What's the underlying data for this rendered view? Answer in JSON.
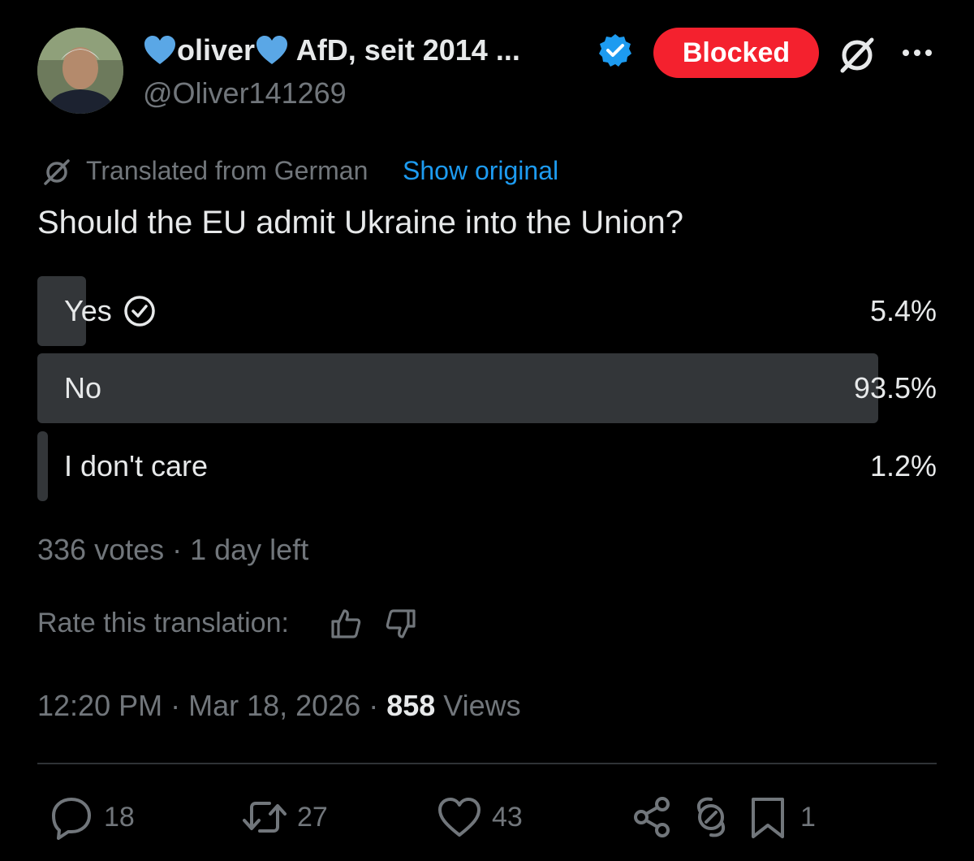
{
  "author": {
    "name_main": "oliver",
    "name_suffix": " AfD, seit 2014 ...",
    "handle": "@Oliver141269",
    "verified": true,
    "heart_color": "#5aa7e6",
    "verified_color": "#1d9bf0"
  },
  "header": {
    "blocked_label": "Blocked",
    "blocked_color": "#f4212e"
  },
  "translation": {
    "label": "Translated from German",
    "show_original": "Show original"
  },
  "post": {
    "text": "Should the EU admit Ukraine into the Union?"
  },
  "poll": {
    "options": [
      {
        "label": "Yes",
        "percent_text": "5.4%",
        "percent": 5.4,
        "voted": true
      },
      {
        "label": "No",
        "percent_text": "93.5%",
        "percent": 93.5,
        "voted": false
      },
      {
        "label": "I don't care",
        "percent_text": "1.2%",
        "percent": 1.2,
        "voted": false
      }
    ],
    "summary": "336 votes · 1 day left"
  },
  "rating": {
    "label": "Rate this translation:"
  },
  "meta": {
    "time_date": "12:20 PM · Mar 18, 2026 · ",
    "views_count": "858",
    "views_label": " Views"
  },
  "actions": {
    "replies": "18",
    "reposts": "27",
    "likes": "43",
    "bookmarks": "1"
  },
  "icons": [
    "grok-icon",
    "more-icon",
    "verified-badge-icon",
    "translate-icon",
    "check-circle-icon",
    "thumbs-up-icon",
    "thumbs-down-icon",
    "reply-icon",
    "repost-icon",
    "like-icon",
    "share-icon",
    "grok-analyze-icon",
    "bookmark-icon"
  ]
}
